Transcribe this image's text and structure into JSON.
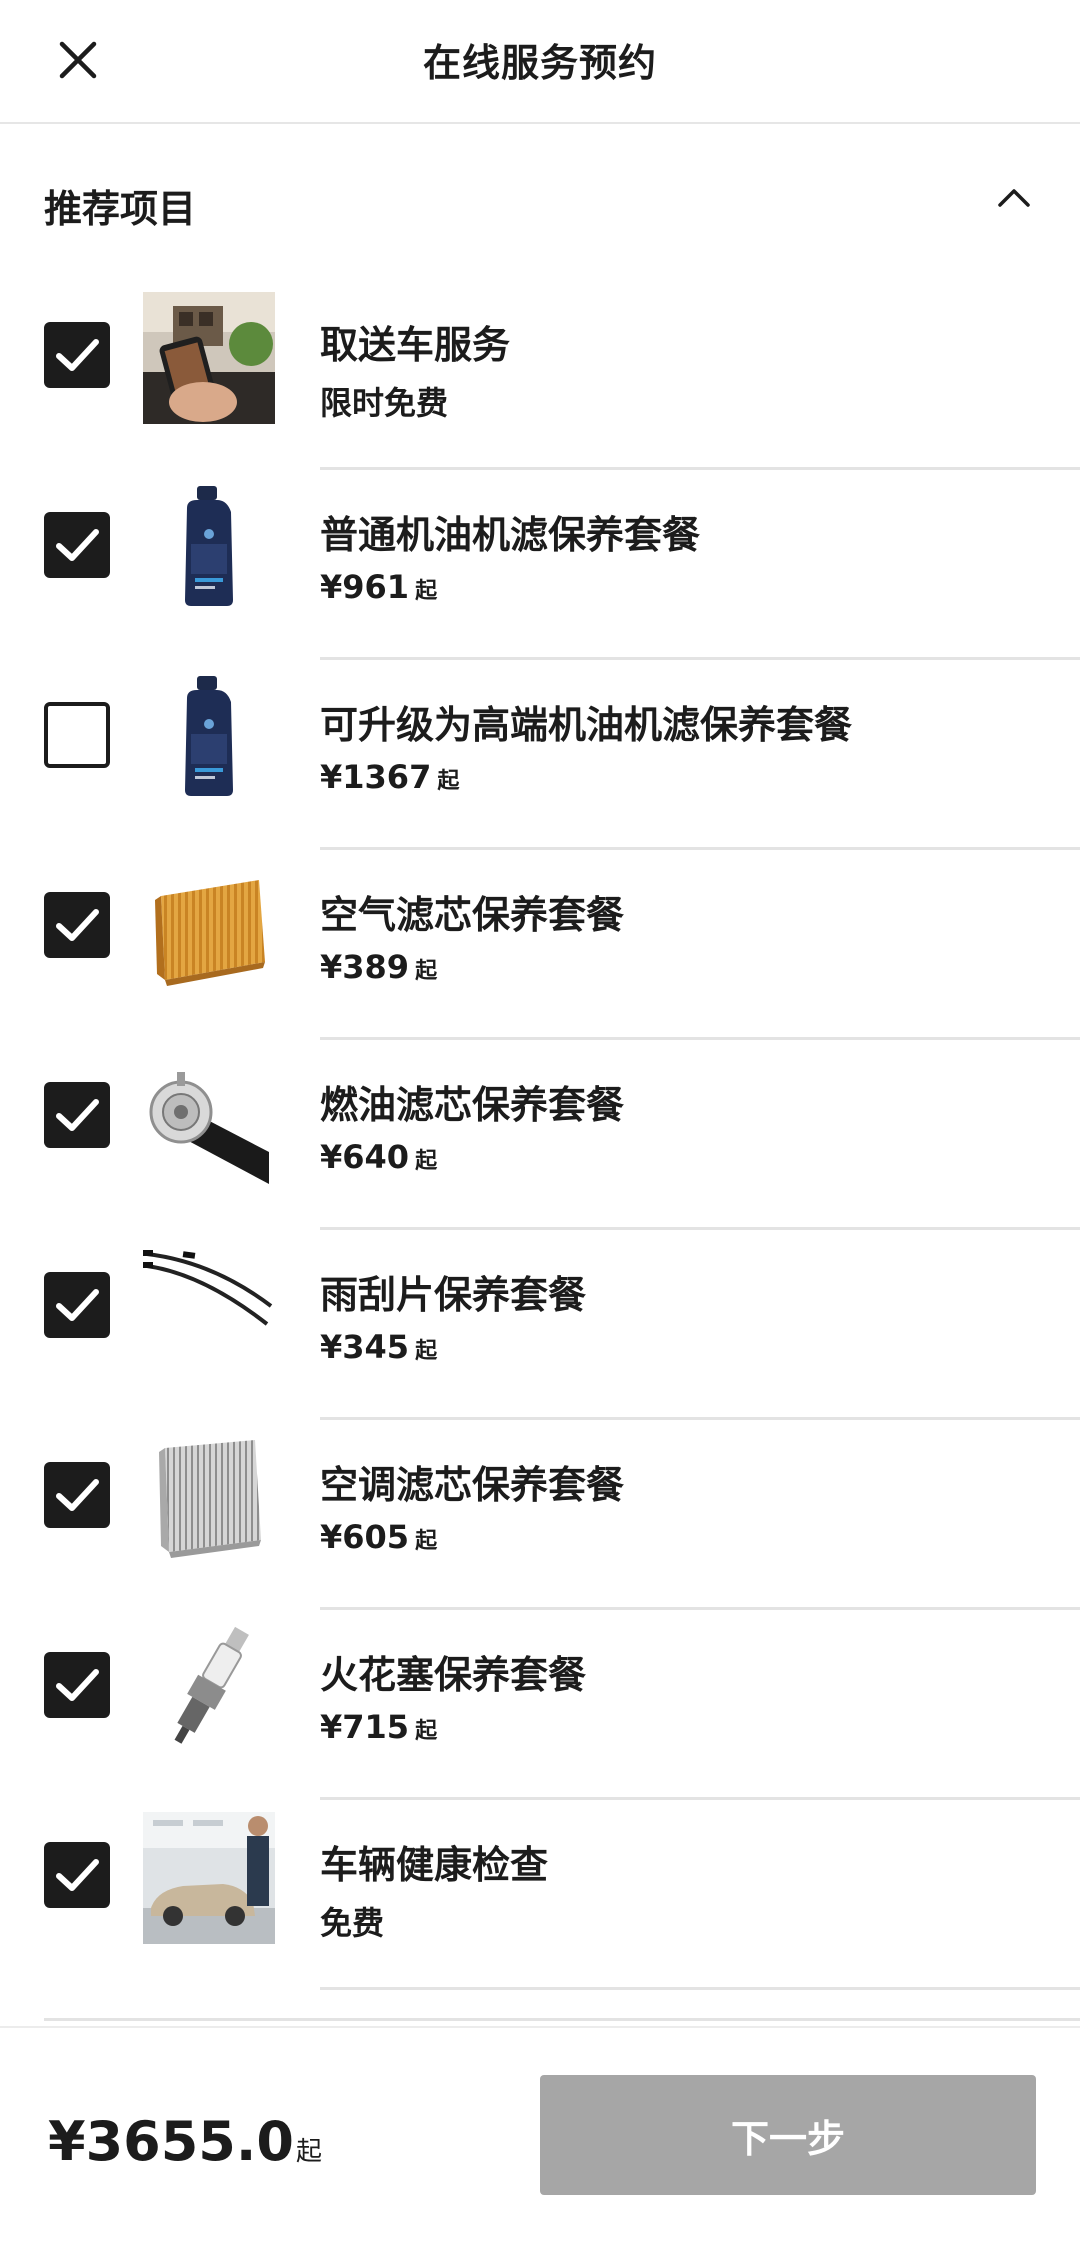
{
  "header": {
    "title": "在线服务预约",
    "close_icon": "close-icon"
  },
  "section": {
    "title": "推荐项目",
    "collapse_icon": "chevron-up-icon"
  },
  "items": [
    {
      "name": "取送车服务",
      "price_text": "限时免费",
      "suffix": "",
      "checked": true,
      "thumb": "pickup-service-photo"
    },
    {
      "name": "普通机油机滤保养套餐",
      "price_text": "¥961",
      "suffix": "起",
      "checked": true,
      "thumb": "engine-oil-bottle"
    },
    {
      "name": "可升级为高端机油机滤保养套餐",
      "price_text": "¥1367",
      "suffix": "起",
      "checked": false,
      "thumb": "engine-oil-bottle"
    },
    {
      "name": "空气滤芯保养套餐",
      "price_text": "¥389",
      "suffix": "起",
      "checked": true,
      "thumb": "air-filter"
    },
    {
      "name": "燃油滤芯保养套餐",
      "price_text": "¥640",
      "suffix": "起",
      "checked": true,
      "thumb": "fuel-filter"
    },
    {
      "name": "雨刮片保养套餐",
      "price_text": "¥345",
      "suffix": "起",
      "checked": true,
      "thumb": "wiper-blades"
    },
    {
      "name": "空调滤芯保养套餐",
      "price_text": "¥605",
      "suffix": "起",
      "checked": true,
      "thumb": "cabin-air-filter"
    },
    {
      "name": "火花塞保养套餐",
      "price_text": "¥715",
      "suffix": "起",
      "checked": true,
      "thumb": "spark-plug"
    },
    {
      "name": "车辆健康检查",
      "price_text": "免费",
      "suffix": "",
      "checked": true,
      "thumb": "vehicle-check-photo"
    }
  ],
  "footer": {
    "total": "¥3655.0",
    "total_suffix": "起",
    "next_label": "下一步"
  },
  "colors": {
    "text": "#1c1c1c",
    "divider": "#e3e3e3",
    "button_disabled": "#a6a6a6"
  }
}
